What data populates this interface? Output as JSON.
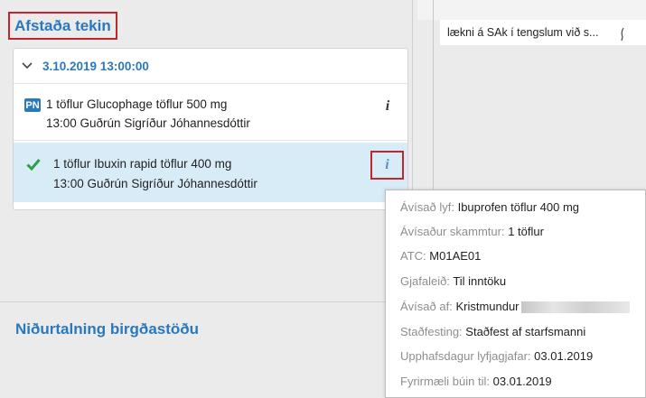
{
  "section": {
    "title": "Afstaða tekin",
    "group_date": "3.10.2019 13:00:00"
  },
  "rows": [
    {
      "badge": "PN",
      "line1": "1 töflur Glucophage töflur 500 mg",
      "line2": "13:00 Guðrún Sigríður Jóhannesdóttir",
      "info": "i"
    },
    {
      "line1": "1 töflur Ibuxin rapid töflur 400 mg",
      "line2": "13:00 Guðrún Sigríður Jóhannesdóttir",
      "info": "i"
    }
  ],
  "subsection": {
    "title": "Niðurtalning birgðastöðu"
  },
  "right_pane": {
    "text": "lækni á SAk í tengslum við s..."
  },
  "tooltip": {
    "rows": [
      {
        "label": "Ávísað lyf:",
        "value": "Ibuprofen töflur 400 mg"
      },
      {
        "label": "Ávísaður skammtur:",
        "value": "1 töflur"
      },
      {
        "label": "ATC:",
        "value": "M01AE01"
      },
      {
        "label": "Gjafaleið:",
        "value": "Til inntöku"
      },
      {
        "label": "Ávísað af:",
        "value": "Kristmundur"
      },
      {
        "label": "Staðfesting:",
        "value": "Staðfest af starfsmanni"
      },
      {
        "label": "Upphafsdagur lyfjagjafar:",
        "value": "03.01.2019"
      },
      {
        "label": "Fyrirmæli búin til:",
        "value": "03.01.2019"
      }
    ]
  },
  "colors": {
    "accent": "#2a78bd",
    "highlight_border": "#c0262c",
    "selected_row": "#d8ecf8",
    "check": "#2e9e48"
  }
}
